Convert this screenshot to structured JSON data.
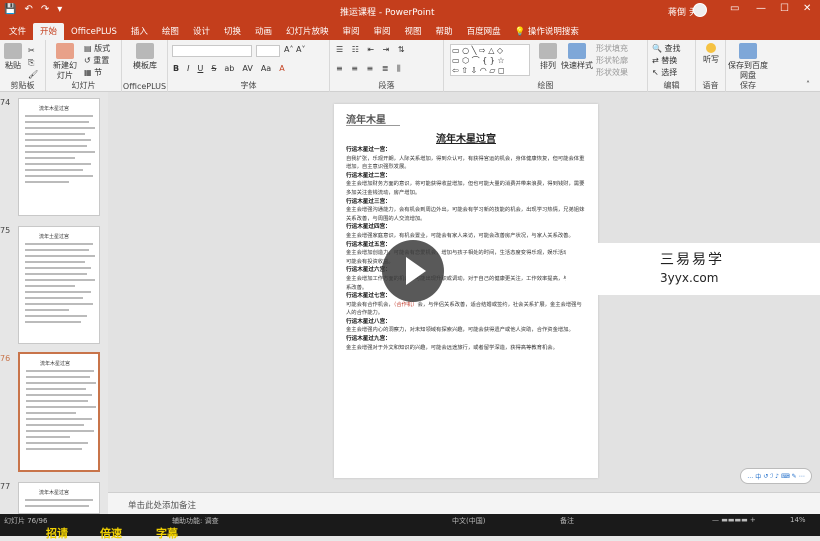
{
  "window": {
    "title": "推运课程 - PowerPoint",
    "user": "蒋倒 尹",
    "quick_access": [
      "💾",
      "↶",
      "↷",
      "▾"
    ],
    "window_buttons": [
      "▭",
      "—",
      "☐",
      "✕"
    ]
  },
  "tabs": [
    "文件",
    "开始",
    "OfficePLUS",
    "插入",
    "绘图",
    "设计",
    "切换",
    "动画",
    "幻灯片放映",
    "审阅",
    "审阅",
    "视图",
    "帮助",
    "百度网盘",
    "操作说明搜索"
  ],
  "ribbon": {
    "paste": "粘贴",
    "new_slide": "新建幻灯片",
    "reuse_slide": "重用幻灯片",
    "layout": "版式",
    "reset": "重置",
    "section": "节",
    "template_lib": "模板库",
    "groups": {
      "clipboard": "剪贴板",
      "slides": "幻灯片",
      "officeplus": "OfficePLUS",
      "font": "字体",
      "paragraph": "段落",
      "drawing": "绘图",
      "editing": "编辑",
      "voice": "语音",
      "save": "保存"
    },
    "font_buttons": [
      "B",
      "I",
      "U",
      "S",
      "ab",
      "AV",
      "Aa",
      "A"
    ],
    "arrange": "排列",
    "quick_styles": "快速样式",
    "find": "查找",
    "replace": "替换",
    "select": "选择",
    "dictate": "听写",
    "save_to_baidu": "保存到百度网盘",
    "shape_fill": "形状填充",
    "shape_outline": "形状轮廓",
    "shape_effects": "形状效果"
  },
  "thumbnails": [
    {
      "num": "74",
      "title": "流年木星过宫"
    },
    {
      "num": "75",
      "title": "流年土星过宫"
    },
    {
      "num": "76",
      "title": "流年木星过宫"
    },
    {
      "num": "77",
      "title": "流年木星过宫"
    }
  ],
  "document": {
    "logo": "流年木星",
    "heading": "流年木星过宫",
    "paragraphs": [
      {
        "head": "行运木星过一宫：",
        "text": "自我扩张，乐观开朗，人际关系增加，得到众认可，有获得官运的机会，身体健康恢复，但可能会体重增加，自主意识强烈发展。"
      },
      {
        "head": "行运木星过二宫：",
        "text": "金主会增加财务方面的意识，将可能获得收益增加，但也可能大量的消费并带来浪费，得到钱财，需要多加关注金钱流动，房产增加。"
      },
      {
        "head": "行运木星过三宫：",
        "text": "金主会增强沟通能力，会有机会到周边外出，可能会有学习新的技能的机会，出现学习热情，兄弟姐妹关系改善，与周围的人交流增加。"
      },
      {
        "head": "行运木星过四宫：",
        "text": "金主会增强家庭意识，有机会置业，可能会有家人来访，可能会改善房产状况，与家人关系改善。"
      },
      {
        "head": "行运木星过五宫：",
        "text": "金主会增加创造力，可能会有恋爱机会，增加与孩子相处的时间，生活态度变得乐观，娱乐活动增多，可能会有投资收益。"
      },
      {
        "head": "行运木星过六宫：",
        "text": "金主会增加工作方面的机会，可能出现升职或调动，对于自己的健康更关注，工作效率提高，与同事关系改善。"
      },
      {
        "head": "行运木星过七宫：",
        "text": "可能会有合作机会，",
        "hl": "（合作机）",
        "text2": "会，与伴侣关系改善，适合结婚或签约，社会关系扩展，金主会增强与人的合作能力。"
      },
      {
        "head": "行运木星过八宫：",
        "text": "金主会增强内心的洞察力，对未知领域有探索兴趣，可能会获得遗产或他人资助，合作资金增加。"
      },
      {
        "head": "行运木星过九宫：",
        "text": "金主会增强对于外文和知识的兴趣，可能会远途旅行，或者留学深造，获得高等教育机会。"
      }
    ]
  },
  "watermark": {
    "line1": "三易易学",
    "line2": "3yyx.com"
  },
  "notes_placeholder": "单击此处添加备注",
  "status": {
    "slide_info": "幻灯片 76/96",
    "language": "中文(中国)",
    "accessibility": "辅助功能: 调查",
    "notes_label": "备注",
    "zoom": "14%",
    "bottom_words": [
      "招请",
      "倍速",
      "字幕"
    ]
  },
  "minitoolbar": [
    "…",
    "中",
    "↺",
    "ℐ",
    "♪",
    "⌨",
    "✎",
    "⋯"
  ]
}
